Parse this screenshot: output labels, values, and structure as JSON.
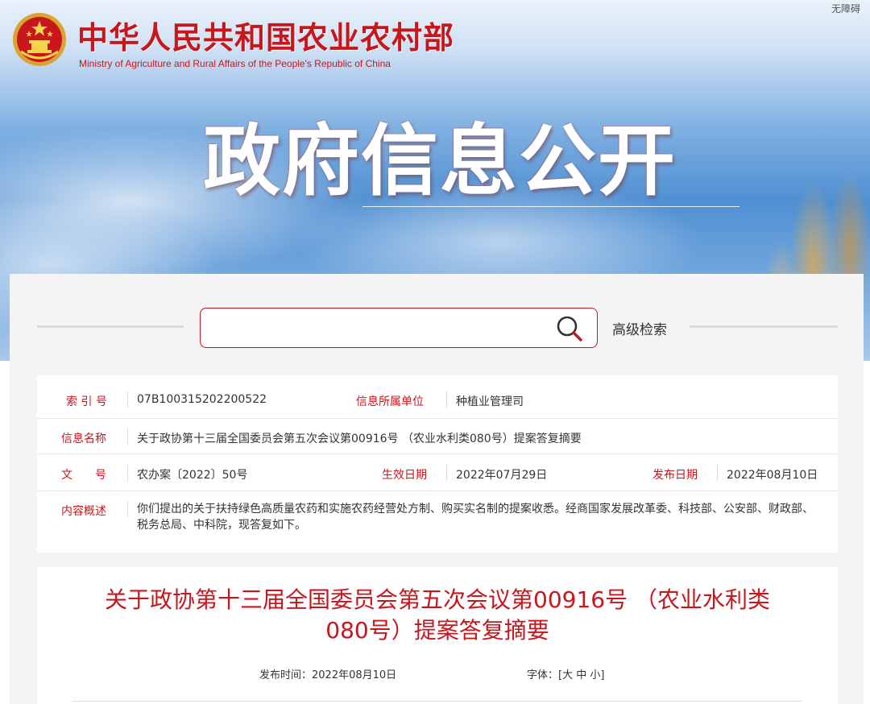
{
  "header": {
    "accessibility_link": "无障碍",
    "site_name_cn": "中华人民共和国农业农村部",
    "site_name_en": "Ministry of Agriculture and Rural Affairs of the People's Republic of China",
    "banner_title": "政府信息公开"
  },
  "search": {
    "placeholder": "",
    "value": "",
    "advanced_label": "高级检索"
  },
  "info": {
    "index_label": "索 引 号",
    "index_value": "07B100315202200522",
    "unit_label": "信息所属单位",
    "unit_value": "种植业管理司",
    "name_label": "信息名称",
    "name_value": "关于政协第十三届全国委员会第五次会议第00916号 （农业水利类080号）提案答复摘要",
    "doc_label": "文　　号",
    "doc_value": "农办案〔2022〕50号",
    "effective_label": "生效日期",
    "effective_value": "2022年07月29日",
    "publish_label": "发布日期",
    "publish_value": "2022年08月10日",
    "summary_label": "内容概述",
    "summary_value": "你们提出的关于扶持绿色高质量农药和实施农药经营处方制、购买实名制的提案收悉。经商国家发展改革委、科技部、公安部、财政部、税务总局、中科院，现答复如下。"
  },
  "article": {
    "title_line1": "关于政协第十三届全国委员会第五次会议第00916号 （农业水利类",
    "title_line2": "080号）提案答复摘要",
    "publish_time": "发布时间：2022年08月10日",
    "font_label": "字体：[",
    "font_large": "大",
    "font_medium": "中",
    "font_small": "小",
    "font_close": "]"
  },
  "colors": {
    "brand_red": "#c8161d",
    "panel_bg": "#f4f4f4"
  },
  "icons": {
    "emblem": "national-emblem-icon",
    "search": "search-icon"
  }
}
